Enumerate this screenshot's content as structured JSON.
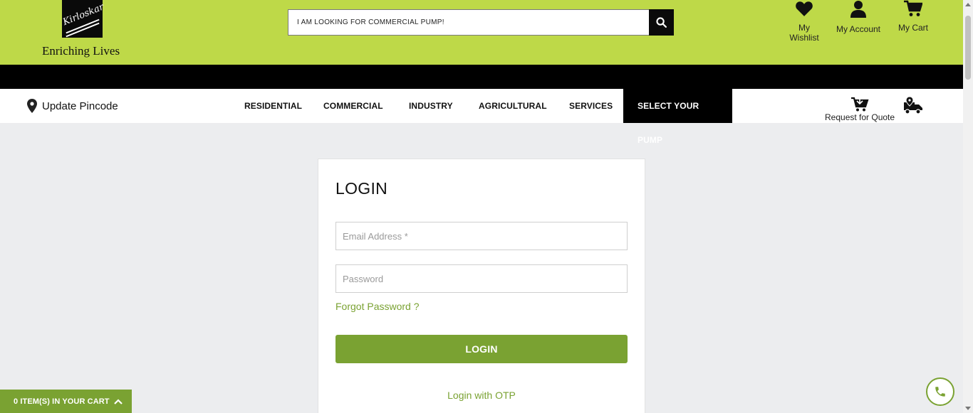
{
  "header": {
    "brand_name": "Kirloskar",
    "tagline": "Enriching Lives",
    "search": {
      "value": "I AM LOOKING FOR COMMERCIAL PUMP!"
    },
    "links": [
      {
        "label": "My Wishlist",
        "icon": "heart-icon"
      },
      {
        "label": "My Account",
        "icon": "user-icon"
      },
      {
        "label": "My Cart",
        "icon": "cart-icon"
      }
    ]
  },
  "nav": {
    "pincode_label": "Update Pincode",
    "items": [
      "RESIDENTIAL",
      "COMMERCIAL",
      "INDUSTRY",
      "AGRICULTURAL",
      "SERVICES",
      "SELECT YOUR PUMP"
    ],
    "active_item": "SELECT YOUR PUMP",
    "rfq_label": "Request for Quote"
  },
  "login": {
    "title": "LOGIN",
    "email_placeholder": "Email Address *",
    "password_placeholder": "Password",
    "forgot_label": "Forgot Password ?",
    "submit_label": "LOGIN",
    "otp_label": "Login with OTP"
  },
  "cart_tab": {
    "label": "0 ITEM(S) IN YOUR CART"
  },
  "colors": {
    "header_green": "#bed948",
    "accent_green": "#7aa232",
    "black": "#000000"
  }
}
